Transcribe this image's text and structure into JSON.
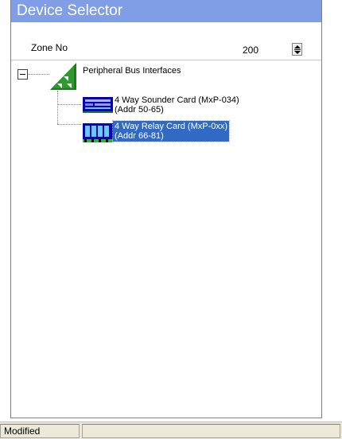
{
  "header": {
    "title": "Device Selector"
  },
  "zone": {
    "label": "Zone No",
    "value": "200"
  },
  "tree": {
    "root": {
      "label": "Peripheral Bus Interfaces",
      "icon": "triangle-bus-icon",
      "expanded": true
    },
    "children": [
      {
        "label_line1": "4 Way Sounder Card (MxP-034)",
        "label_line2": "(Addr 50-65)",
        "icon": "sounder-card-icon",
        "selected": false
      },
      {
        "label_line1": "4 Way Relay Card   (MxP-0xx)",
        "label_line2": "(Addr 66-81)",
        "icon": "relay-card-icon",
        "selected": true
      }
    ]
  },
  "status": {
    "left_text": "Modified",
    "right_text": ""
  },
  "colors": {
    "title_bg": "#7f9ee6",
    "selection_bg": "#316ac5",
    "icon_green": "#1f7a1f",
    "card_blue": "#0000c0"
  }
}
